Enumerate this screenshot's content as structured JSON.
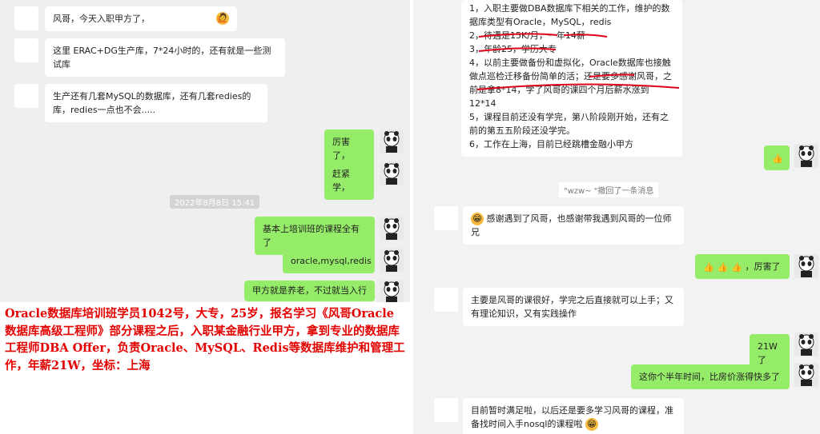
{
  "left": {
    "messages": [
      {
        "text": "风哥，今天入职甲方了，"
      },
      {
        "text": "这里            ERAC+DG生产库，7*24小时的，还有就是一些测试库"
      },
      {
        "text": "生产还有几套MySQL的数据库，还有几套redies的库，redies一点也不会....."
      },
      {
        "text": "厉害了，"
      },
      {
        "text": "赶紧学，"
      },
      {
        "text": "基本上培训班的课程全有了"
      },
      {
        "text": "oracle,mysql,redis"
      },
      {
        "text": "甲方就是养老，不过就当入行"
      }
    ],
    "timestamp": "2022年8月8日 15:41"
  },
  "caption": {
    "text": "Oracle数据库培训班学员1042号，大专，25岁，报名学习《风哥Oracle数据库高级工程师》部分课程之后，入职某金融行业甲方，拿到专业的数据库工程师DBA Offer，负责Oracle、MySQL、Redis等数据库维护和管理工作，年薪21W，坐标：上海"
  },
  "right": {
    "intro_lines": [
      "1，入职主要做DBA数据库下相关的工作，维护的数据库类型有Oracle，MySQL，redis",
      "2，待遇是15K/月，一年14薪",
      "3，年龄25，学历大专",
      "4，以前主要做备份和虚拟化，Oracle数据库也接触做点巡检迁移备份简单的活；还是要多感谢风哥，之前是拿8*14，学了风哥的课四个月后薪水涨到12*14",
      "5，课程目前还没有学完，第八阶段刚开始，还有之前的第五五阶段还没学完。",
      "6，工作在上海，目前已经跳槽金融小甲方"
    ],
    "system_note": "\"wzw~                                          \"撤回了一条消息",
    "messages": [
      {
        "text": "感谢遇到了风哥，也感谢带我遇到风哥的一位师兄"
      },
      {
        "text": "，厉害了"
      },
      {
        "text": "主要是风哥的课很好，学完之后直接就可以上手；又有理论知识，又有实践操作"
      },
      {
        "text": "21W了"
      },
      {
        "text": "这你个半年时间，比房价涨得快多了"
      },
      {
        "text": "目前暂时满足啦，以后还是要多学习风哥的课程，准备找时间入手nosql的课程啦"
      }
    ]
  },
  "icons": {
    "grin": "😁",
    "thumbs": "👍",
    "wave": "🙋"
  },
  "colors": {
    "my_bubble": "#95ec69",
    "annotation": "#e1001c"
  }
}
